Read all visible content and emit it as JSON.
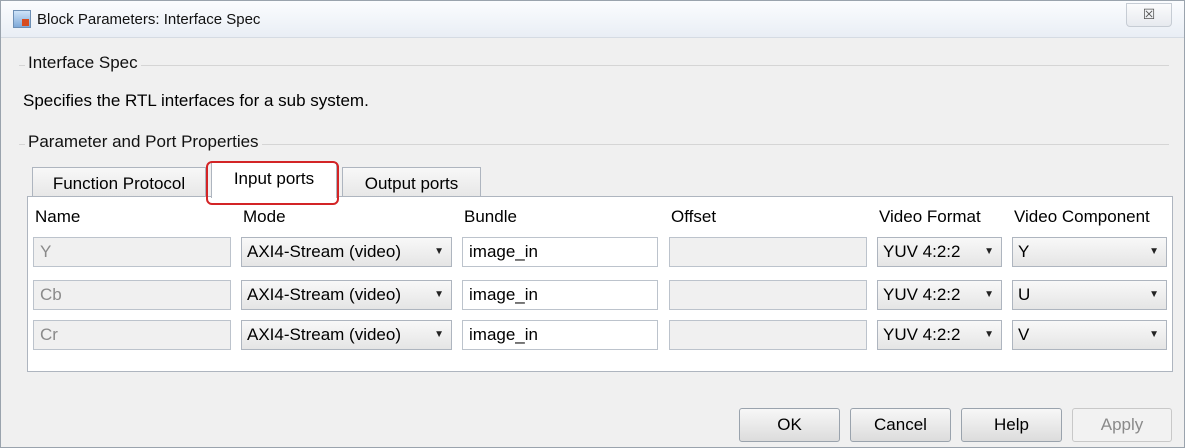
{
  "window": {
    "title": "Block Parameters: Interface Spec",
    "close_glyph": "☒"
  },
  "group1": {
    "title": "Interface Spec",
    "description": "Specifies the RTL interfaces for a sub system."
  },
  "group2": {
    "title": "Parameter and Port Properties"
  },
  "tabs": [
    {
      "label": "Function Protocol",
      "active": false
    },
    {
      "label": "Input ports",
      "active": true
    },
    {
      "label": "Output ports",
      "active": false
    }
  ],
  "table": {
    "headers": [
      "Name",
      "Mode",
      "Bundle",
      "Offset",
      "Video Format",
      "Video Component"
    ],
    "rows": [
      {
        "name": "Y",
        "mode": "AXI4-Stream (video)",
        "bundle": "image_in",
        "offset": "",
        "video_format": "YUV 4:2:2",
        "video_component": "Y"
      },
      {
        "name": "Cb",
        "mode": "AXI4-Stream (video)",
        "bundle": "image_in",
        "offset": "",
        "video_format": "YUV 4:2:2",
        "video_component": "U"
      },
      {
        "name": "Cr",
        "mode": "AXI4-Stream (video)",
        "bundle": "image_in",
        "offset": "",
        "video_format": "YUV 4:2:2",
        "video_component": "V"
      }
    ]
  },
  "buttons": {
    "ok": "OK",
    "cancel": "Cancel",
    "help": "Help",
    "apply": "Apply"
  },
  "colors": {
    "highlight": "#d32426"
  }
}
